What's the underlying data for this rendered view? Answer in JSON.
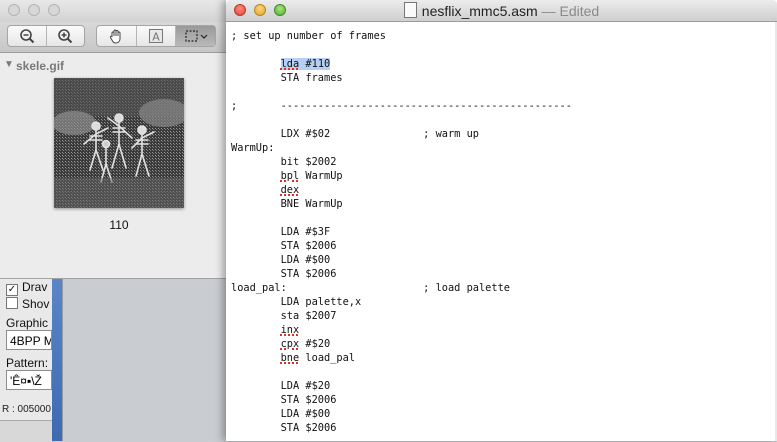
{
  "background_app": {
    "rows": [
      {
        "label": "Drav",
        "checked": true
      },
      {
        "label": "Shov",
        "checked": false
      }
    ],
    "graphics_label": "Graphic",
    "graphics_value": "4BPP M",
    "pattern_label": "Pattern:",
    "pattern_value": "'Ê¤▪\\Ž",
    "status": "R : 005000"
  },
  "preview": {
    "sidebar_title": "skele.gif",
    "thumbnail_caption": "110",
    "toolbar_icons": [
      "zoom-out-icon",
      "zoom-in-icon",
      "hand-icon",
      "text-select-icon",
      "rect-select-icon"
    ]
  },
  "editor": {
    "filename": "nesflix_mmc5.asm",
    "status": "— Edited",
    "lines": [
      "; set up number of frames",
      "",
      "        lda #110",
      "        STA frames",
      "",
      ";       -----------------------------------------------",
      "",
      "        LDX #$02               ; warm up",
      "WarmUp:",
      "        bit $2002",
      "        bpl WarmUp",
      "        dex",
      "        BNE WarmUp",
      "",
      "        LDA #$3F",
      "        STA $2006",
      "        LDA #$00",
      "        STA $2006",
      "load_pal:                      ; load palette",
      "        LDA palette,x",
      "        sta $2007",
      "        inx",
      "        cpx #$20",
      "        bne load_pal",
      "",
      "        LDA #$20",
      "        STA $2006",
      "        LDA #$00",
      "        STA $2006"
    ],
    "selection": {
      "line": 2,
      "text": "lda #110"
    },
    "misspelled": [
      {
        "line": 2,
        "word": "lda"
      },
      {
        "line": 10,
        "word": "bpl"
      },
      {
        "line": 11,
        "word": "dex"
      },
      {
        "line": 21,
        "word": "inx"
      },
      {
        "line": 22,
        "word": "cpx"
      },
      {
        "line": 23,
        "word": "bne"
      }
    ]
  }
}
